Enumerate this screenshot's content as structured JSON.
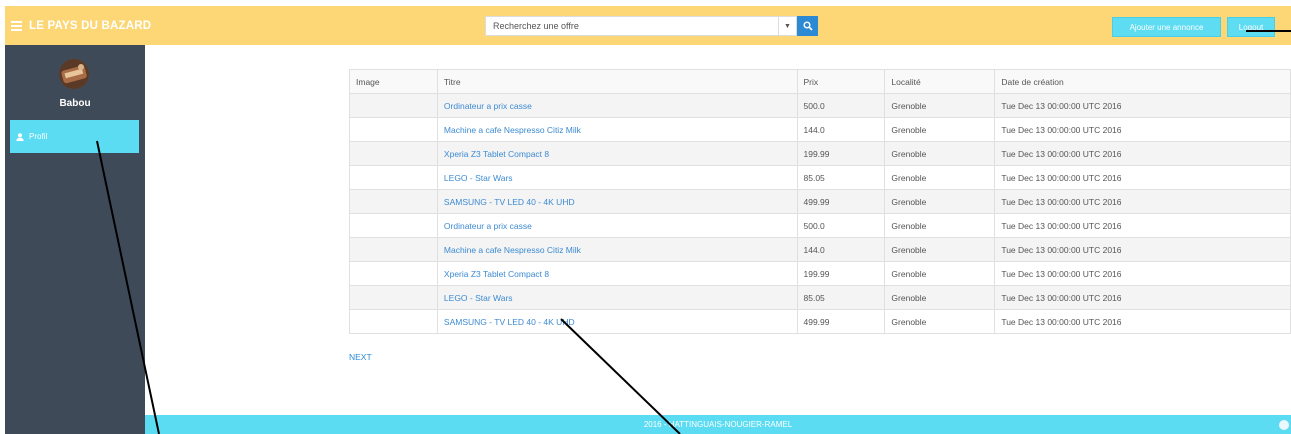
{
  "header": {
    "brand": "LE PAYS DU BAZARD",
    "search_placeholder": "Recherchez une offre",
    "add_button": "Ajouter une annonce",
    "logout_button": "Logout"
  },
  "sidebar": {
    "username": "Babou",
    "nav_profile": "Profil"
  },
  "table": {
    "headers": [
      "Image",
      "Titre",
      "Prix",
      "Localité",
      "Date de création"
    ],
    "rows": [
      {
        "image": "",
        "title": "Ordinateur a prix casse",
        "price": "500.0",
        "location": "Grenoble",
        "date": "Tue Dec 13 00:00:00 UTC 2016"
      },
      {
        "image": "",
        "title": "Machine a cafe Nespresso Citiz Milk",
        "price": "144.0",
        "location": "Grenoble",
        "date": "Tue Dec 13 00:00:00 UTC 2016"
      },
      {
        "image": "",
        "title": "Xperia Z3 Tablet Compact 8",
        "price": "199.99",
        "location": "Grenoble",
        "date": "Tue Dec 13 00:00:00 UTC 2016"
      },
      {
        "image": "",
        "title": "LEGO - Star Wars",
        "price": "85.05",
        "location": "Grenoble",
        "date": "Tue Dec 13 00:00:00 UTC 2016"
      },
      {
        "image": "",
        "title": "SAMSUNG - TV LED 40 - 4K UHD",
        "price": "499.99",
        "location": "Grenoble",
        "date": "Tue Dec 13 00:00:00 UTC 2016"
      },
      {
        "image": "",
        "title": "Ordinateur a prix casse",
        "price": "500.0",
        "location": "Grenoble",
        "date": "Tue Dec 13 00:00:00 UTC 2016"
      },
      {
        "image": "",
        "title": "Machine a cafe Nespresso Citiz Milk",
        "price": "144.0",
        "location": "Grenoble",
        "date": "Tue Dec 13 00:00:00 UTC 2016"
      },
      {
        "image": "",
        "title": "Xperia Z3 Tablet Compact 8",
        "price": "199.99",
        "location": "Grenoble",
        "date": "Tue Dec 13 00:00:00 UTC 2016"
      },
      {
        "image": "",
        "title": "LEGO - Star Wars",
        "price": "85.05",
        "location": "Grenoble",
        "date": "Tue Dec 13 00:00:00 UTC 2016"
      },
      {
        "image": "",
        "title": "SAMSUNG - TV LED 40 - 4K UHD",
        "price": "499.99",
        "location": "Grenoble",
        "date": "Tue Dec 13 00:00:00 UTC 2016"
      }
    ]
  },
  "pagination": {
    "next": "NEXT"
  },
  "footer": {
    "text": "2016 - HATTINGUAIS-NOUGIER-RAMEL"
  },
  "icons": {
    "menu": "hamburger-menu-icon",
    "search": "search-icon",
    "dropdown": "caret-down-icon",
    "user": "user-icon",
    "scroll_top": "chevron-up-icon"
  },
  "colors": {
    "header": "#fdd776",
    "sidebar": "#3f4a59",
    "accent": "#5cdcf3",
    "link": "#3c8ad2",
    "search_button": "#2c8ad4"
  }
}
